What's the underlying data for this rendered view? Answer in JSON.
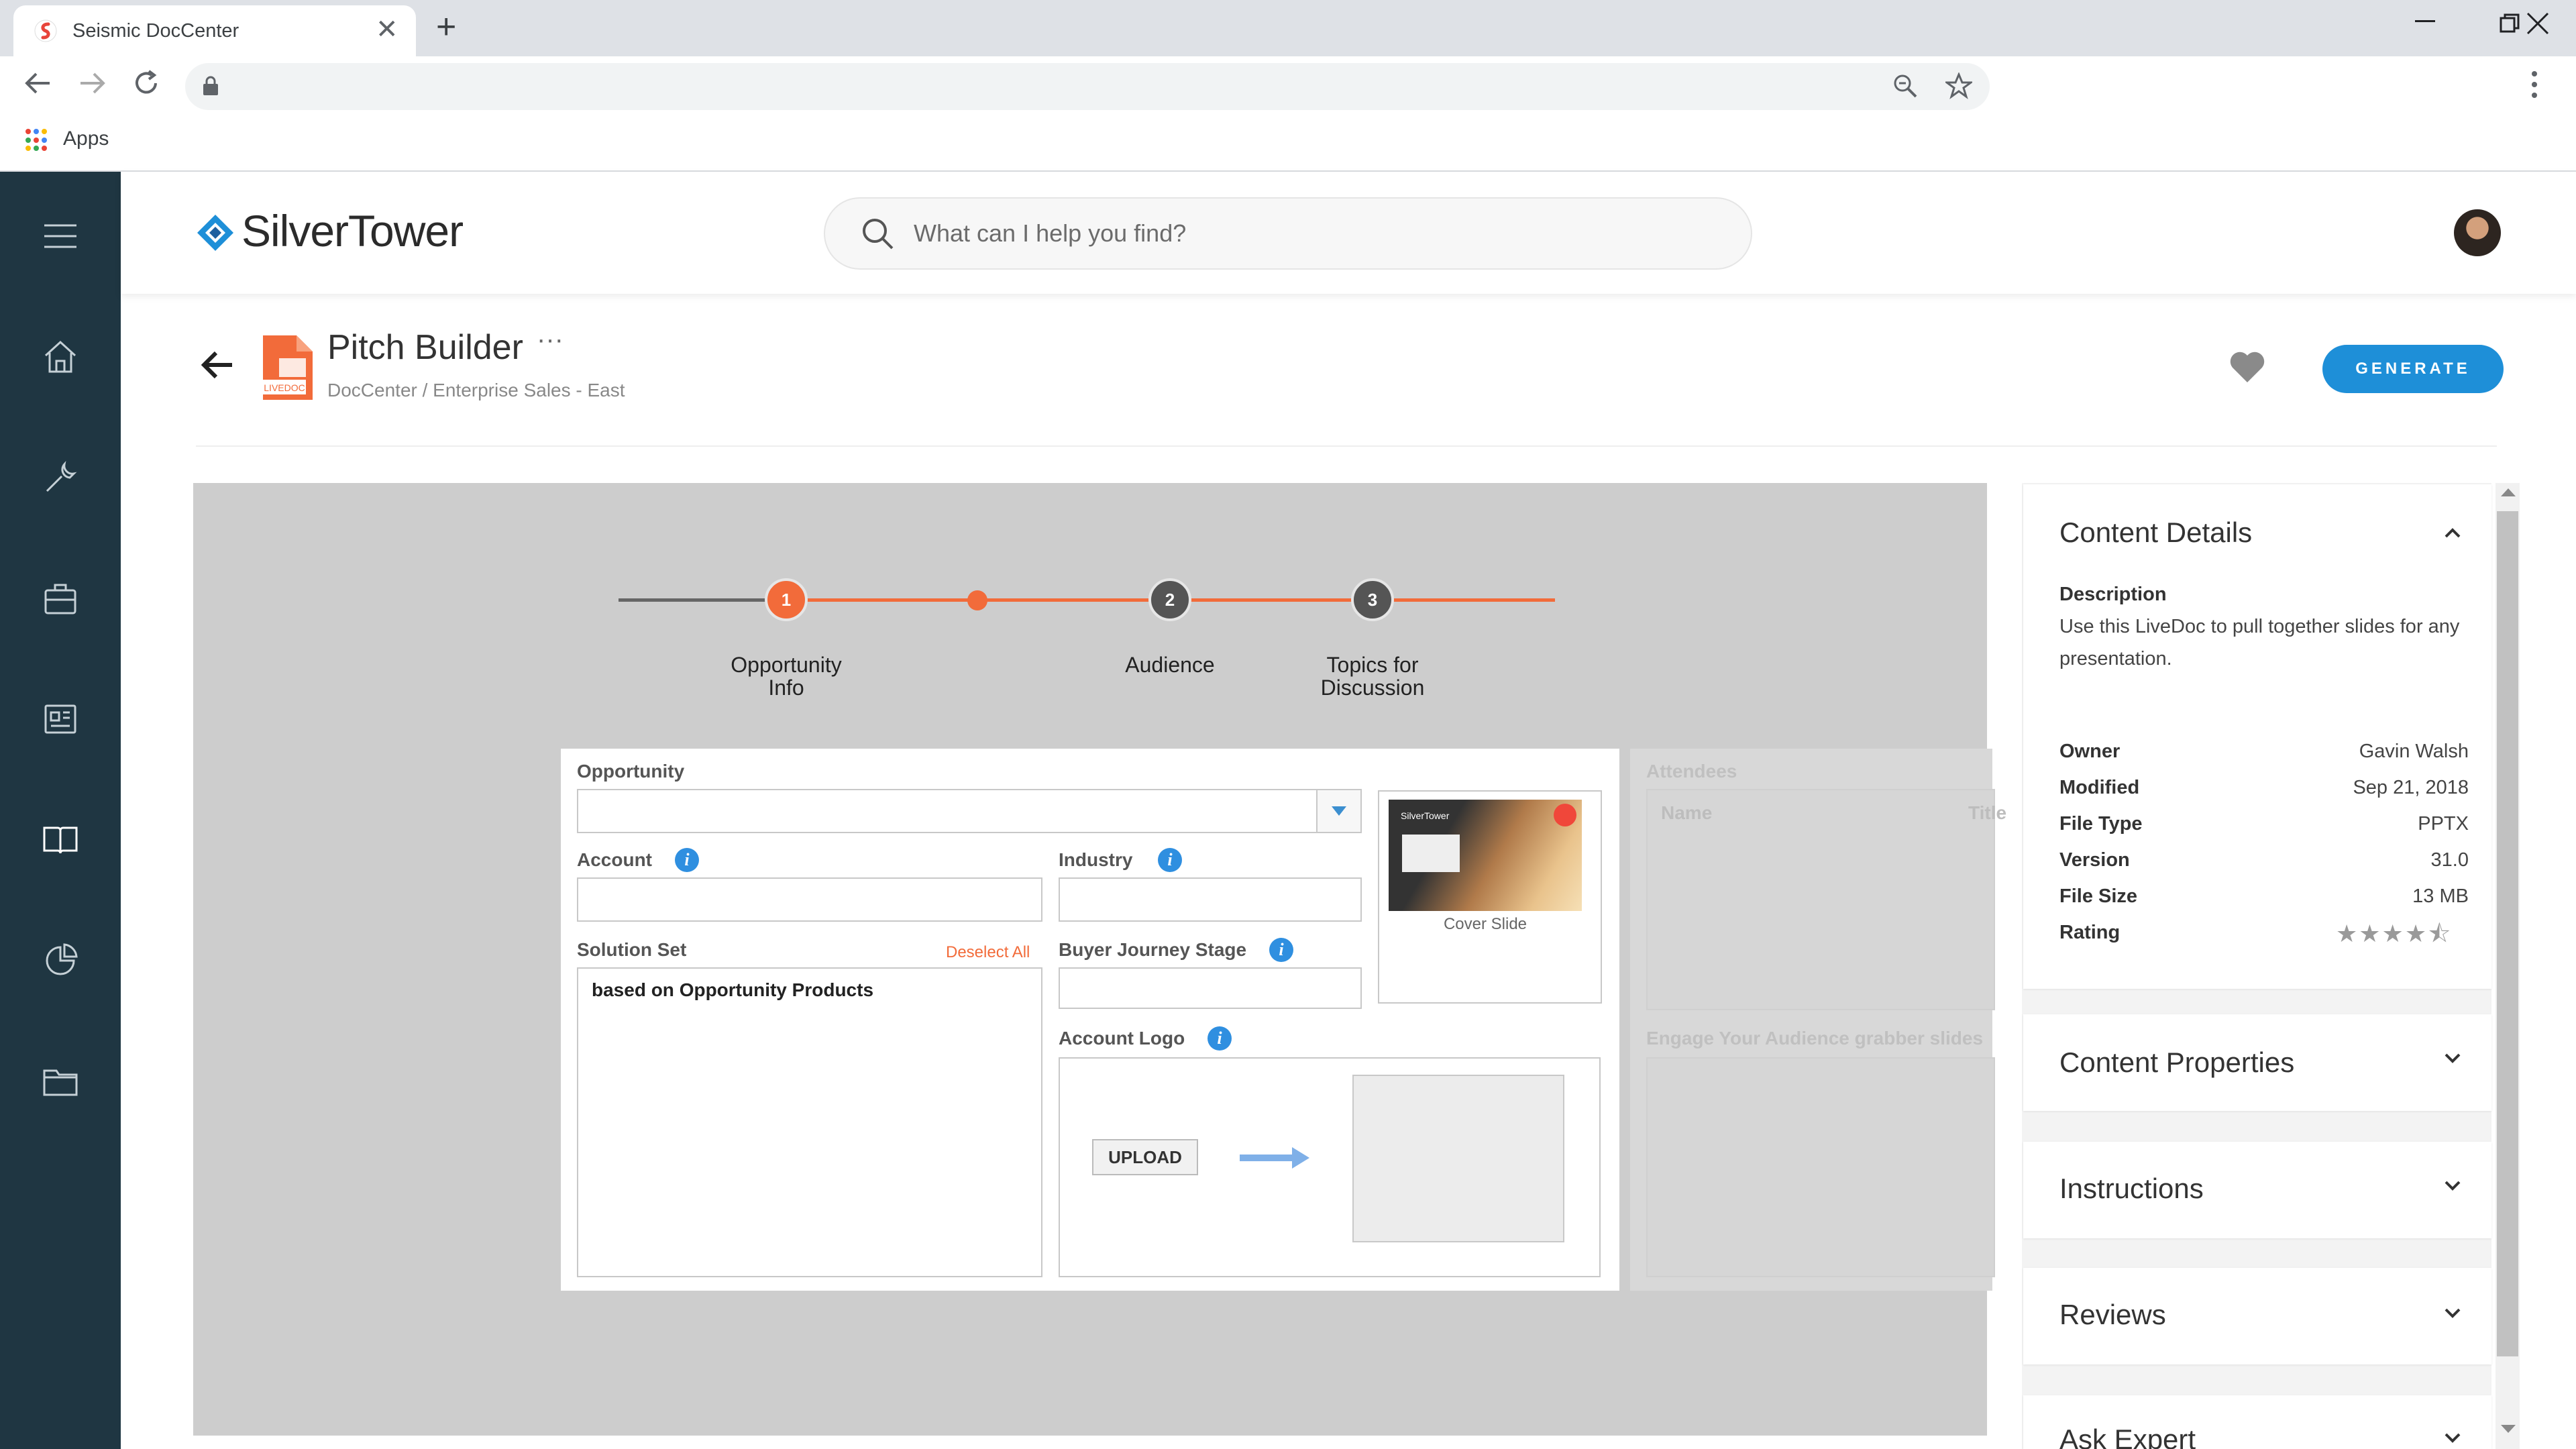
{
  "browser": {
    "tab_title": "Seismic DocCenter",
    "tab_close": "✕",
    "new_tab": "+",
    "bookmarks_apps": "Apps"
  },
  "app": {
    "logo_text": "SilverTower",
    "search_placeholder": "What can I help you find?",
    "brand_color": "#1e8fd8",
    "sidebar_color": "#1f3642"
  },
  "page": {
    "title": "Pitch Builder",
    "more": "···",
    "breadcrumb": "DocCenter / Enterprise Sales - East",
    "file_badge": "LIVEDOC",
    "generate_label": "GENERATE"
  },
  "wizard": {
    "steps": [
      {
        "number": "1",
        "label": "Opportunity Info"
      },
      {
        "number": "2",
        "label": "Audience"
      },
      {
        "number": "3",
        "label": "Topics for Discussion"
      }
    ],
    "accent_color": "#f26b3a"
  },
  "form": {
    "opportunity_label": "Opportunity",
    "opportunity_value": "",
    "account_label": "Account",
    "account_value": "",
    "industry_label": "Industry",
    "industry_value": "",
    "solution_set_label": "Solution Set",
    "deselect_all": "Deselect All",
    "solution_set_value": "based on Opportunity Products",
    "buyer_journey_label": "Buyer Journey Stage",
    "buyer_journey_value": "",
    "account_logo_label": "Account Logo",
    "upload_label": "UPLOAD",
    "cover_slide_label": "Cover Slide",
    "cover_thumb_brand": "SilverTower",
    "info_glyph": "i",
    "attendees_label": "Attendees",
    "attendees_col_name": "Name",
    "attendees_col_title": "Title",
    "grabber_label": "Engage Your Audience grabber slides"
  },
  "details": {
    "content_details_title": "Content Details",
    "description_label": "Description",
    "description_text": "Use this LiveDoc to pull together slides for any presentation.",
    "rows": [
      {
        "label": "Owner",
        "value": "Gavin Walsh"
      },
      {
        "label": "Modified",
        "value": "Sep 21, 2018"
      },
      {
        "label": "File Type",
        "value": "PPTX"
      },
      {
        "label": "Version",
        "value": "31.0"
      },
      {
        "label": "File Size",
        "value": "13 MB"
      },
      {
        "label": "Rating",
        "value": ""
      }
    ],
    "rating": 4.5,
    "rating_stars": "★★★★⯪",
    "sections": [
      "Content Properties",
      "Instructions",
      "Reviews",
      "Ask Expert"
    ]
  }
}
